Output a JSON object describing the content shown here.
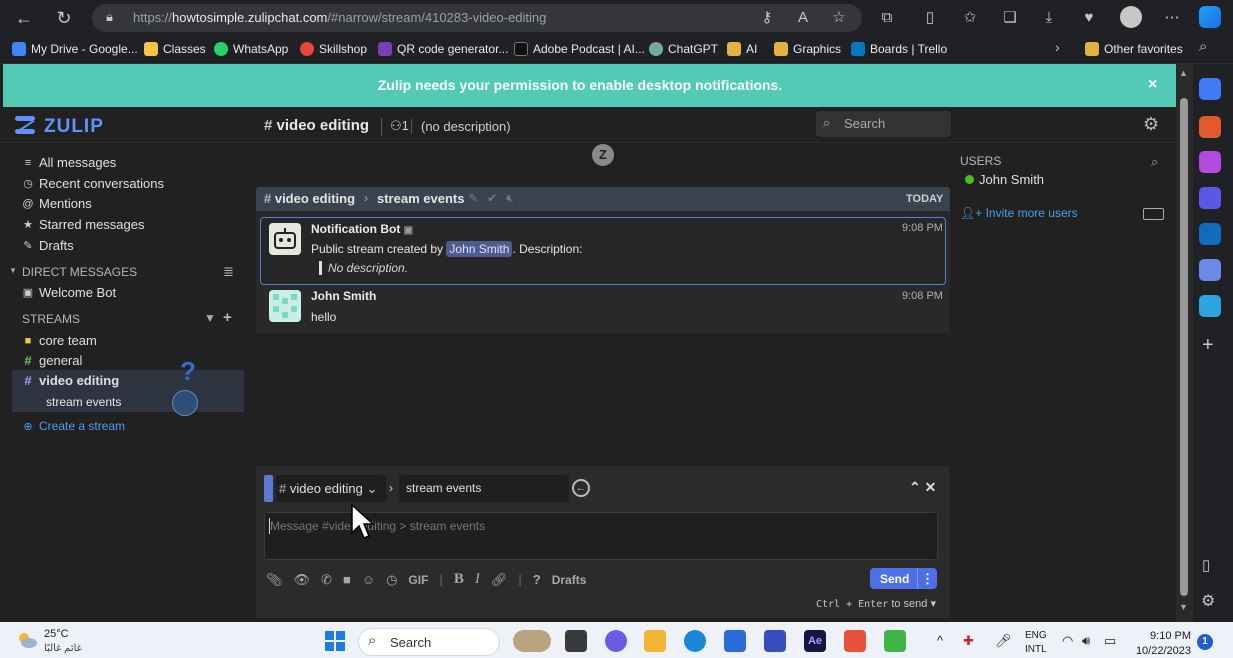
{
  "browser": {
    "url_prefix": "https://",
    "url_host": "howtosimple.zulipchat.com",
    "url_path": "/#narrow/stream/410283-video-editing",
    "bookmarks": [
      {
        "label": "My Drive - Google...",
        "color": "#4285f4"
      },
      {
        "label": "Classes",
        "color": "#f4c542"
      },
      {
        "label": "WhatsApp",
        "color": "#25d366"
      },
      {
        "label": "Skillshop",
        "color": "#e8453c"
      },
      {
        "label": "QR code generator...",
        "color": "#7b3fb5"
      },
      {
        "label": "Adobe Podcast | AI...",
        "color": "#111111"
      },
      {
        "label": "ChatGPT",
        "color": "#74aa9c"
      },
      {
        "label": "AI",
        "color": "#e3b341"
      },
      {
        "label": "Graphics",
        "color": "#e3b341"
      },
      {
        "label": "Boards | Trello",
        "color": "#0079bf"
      }
    ],
    "other_favorites": "Other favorites"
  },
  "banner": {
    "text": "Zulip needs your permission to enable desktop notifications.",
    "close": "×"
  },
  "header": {
    "logo": "ZULIP",
    "stream": "video editing",
    "subscriber_count": "1",
    "description": "(no description)",
    "search_placeholder": "Search"
  },
  "left_sidebar": {
    "views": [
      {
        "label": "All messages",
        "icon": "≡"
      },
      {
        "label": "Recent conversations",
        "icon": "◷"
      },
      {
        "label": "Mentions",
        "icon": "@"
      },
      {
        "label": "Starred messages",
        "icon": "★"
      },
      {
        "label": "Drafts",
        "icon": "✎"
      }
    ],
    "dm_header": "DIRECT MESSAGES",
    "dms": [
      "Welcome Bot"
    ],
    "streams_header": "STREAMS",
    "streams": [
      {
        "label": "core team",
        "icon": "🔒"
      },
      {
        "label": "general",
        "icon": "#"
      },
      {
        "label": "video editing",
        "icon": "#"
      }
    ],
    "topic": "stream events",
    "create_stream": "Create a stream"
  },
  "right_sidebar": {
    "title": "USERS",
    "users": [
      "John Smith"
    ],
    "invite": "Invite more users"
  },
  "messages": {
    "recipient_stream": "video editing",
    "recipient_topic": "stream events",
    "date": "TODAY",
    "items": [
      {
        "sender": "Notification Bot",
        "time": "9:08 PM",
        "line_pre": "Public stream created by",
        "mention": "John Smith",
        "line_post": ". Description:",
        "quote": "No description."
      },
      {
        "sender": "John Smith",
        "time": "9:08 PM",
        "body": "hello"
      }
    ]
  },
  "compose": {
    "stream": "video editing",
    "topic": "stream events",
    "placeholder": "Message #video editing > stream events",
    "gif": "GIF",
    "drafts": "Drafts",
    "send": "Send",
    "hint_keys": "Ctrl + Enter",
    "hint_suffix": "to send"
  },
  "taskbar": {
    "temp": "25°C",
    "weather_desc": "غائم غالبًا",
    "search": "Search",
    "lang1": "ENG",
    "lang2": "INTL",
    "time": "9:10 PM",
    "date": "10/22/2023",
    "badge": "1"
  },
  "colors": {
    "banner": "#54c9b6",
    "accent": "#5b7bd6",
    "send_button": "#4d70e7",
    "online": "#44c21d"
  }
}
